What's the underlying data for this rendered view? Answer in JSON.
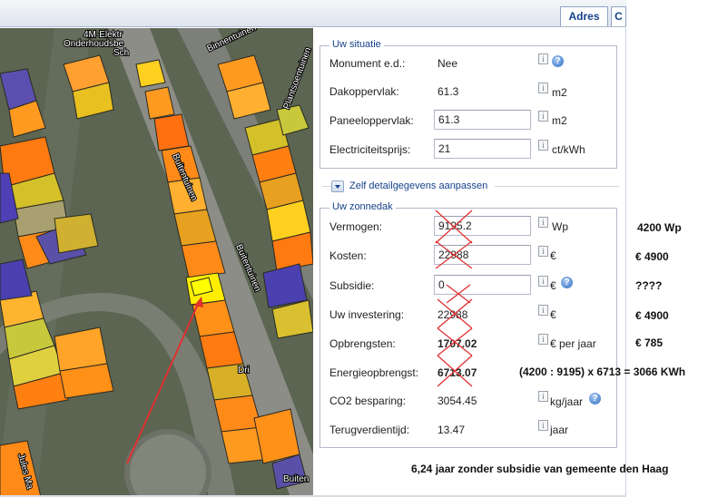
{
  "tabs": {
    "adres": "Adres",
    "second": "C"
  },
  "map": {
    "street_labels": [
      "4M-Elektr",
      "Onderhoudsbe",
      "Sch",
      "Binnentuinen",
      "Plantsoentuinen",
      "Buitentuinen",
      "Buitentuinen",
      "Dri",
      "Jules Ma",
      "Buiten"
    ]
  },
  "situatie": {
    "title": "Uw situatie",
    "monument_label": "Monument e.d.:",
    "monument_value": "Nee",
    "dak_label": "Dakoppervlak:",
    "dak_value": "61.3",
    "dak_unit": "m2",
    "paneel_label": "Paneeloppervlak:",
    "paneel_value": "61.3",
    "paneel_unit": "m2",
    "prijs_label": "Electriciteitsprijs:",
    "prijs_value": "21",
    "prijs_unit": "ct/kWh"
  },
  "expander_label": "Zelf detailgegevens aanpassen",
  "zonnedak": {
    "title": "Uw zonnedak",
    "vermogen_label": "Vermogen:",
    "vermogen_value": "9195.2",
    "vermogen_unit": "Wp",
    "kosten_label": "Kosten:",
    "kosten_value": "22988",
    "kosten_unit": "€",
    "subsidie_label": "Subsidie:",
    "subsidie_value": "0",
    "subsidie_unit": "€",
    "investering_label": "Uw investering:",
    "investering_value": "22988",
    "investering_unit": "€",
    "opbrengsten_label": "Opbrengsten:",
    "opbrengsten_value": "1707.02",
    "opbrengsten_unit": "€ per jaar",
    "energie_label": "Energieopbrengst:",
    "energie_value": "6713.07",
    "co2_label": "CO2 besparing:",
    "co2_value": "3054.45",
    "co2_unit": "kg/jaar",
    "terug_label": "Terugverdientijd:",
    "terug_value": "13.47",
    "terug_unit": "jaar"
  },
  "annotations": {
    "vermogen": "4200 Wp",
    "kosten": "€ 4900",
    "subsidie": "????",
    "investering": "€ 4900",
    "opbrengsten": "€ 785",
    "energie": "(4200 : 9195) x 6713 = 3066 KWh",
    "bottom": "6,24 jaar zonder subsidie van gemeente den Haag"
  },
  "icons": {
    "info": "info-icon",
    "help": "help-icon"
  },
  "colors": {
    "accent": "#15428b",
    "highlight": "#ffff00",
    "arrow": "#e03030"
  }
}
